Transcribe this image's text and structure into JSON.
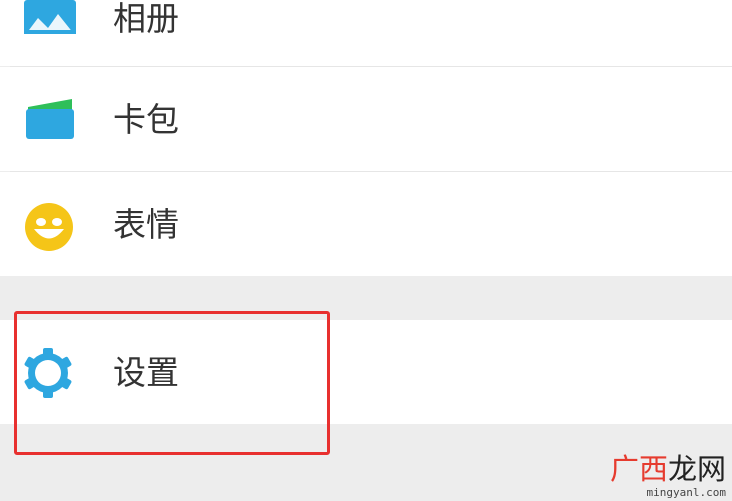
{
  "menu": {
    "items": [
      {
        "label": "相册",
        "icon": "album-icon"
      },
      {
        "label": "卡包",
        "icon": "wallet-icon"
      },
      {
        "label": "表情",
        "icon": "emoji-icon"
      },
      {
        "label": "设置",
        "icon": "settings-icon"
      }
    ]
  },
  "watermark": {
    "chars": [
      "广",
      "西",
      "龙",
      "网"
    ],
    "url": "mingyanl.com"
  },
  "colors": {
    "accent": "#2ea7e0",
    "highlight": "#e8302f",
    "emoji": "#f5c518",
    "wallet_green": "#2fbf5a"
  }
}
